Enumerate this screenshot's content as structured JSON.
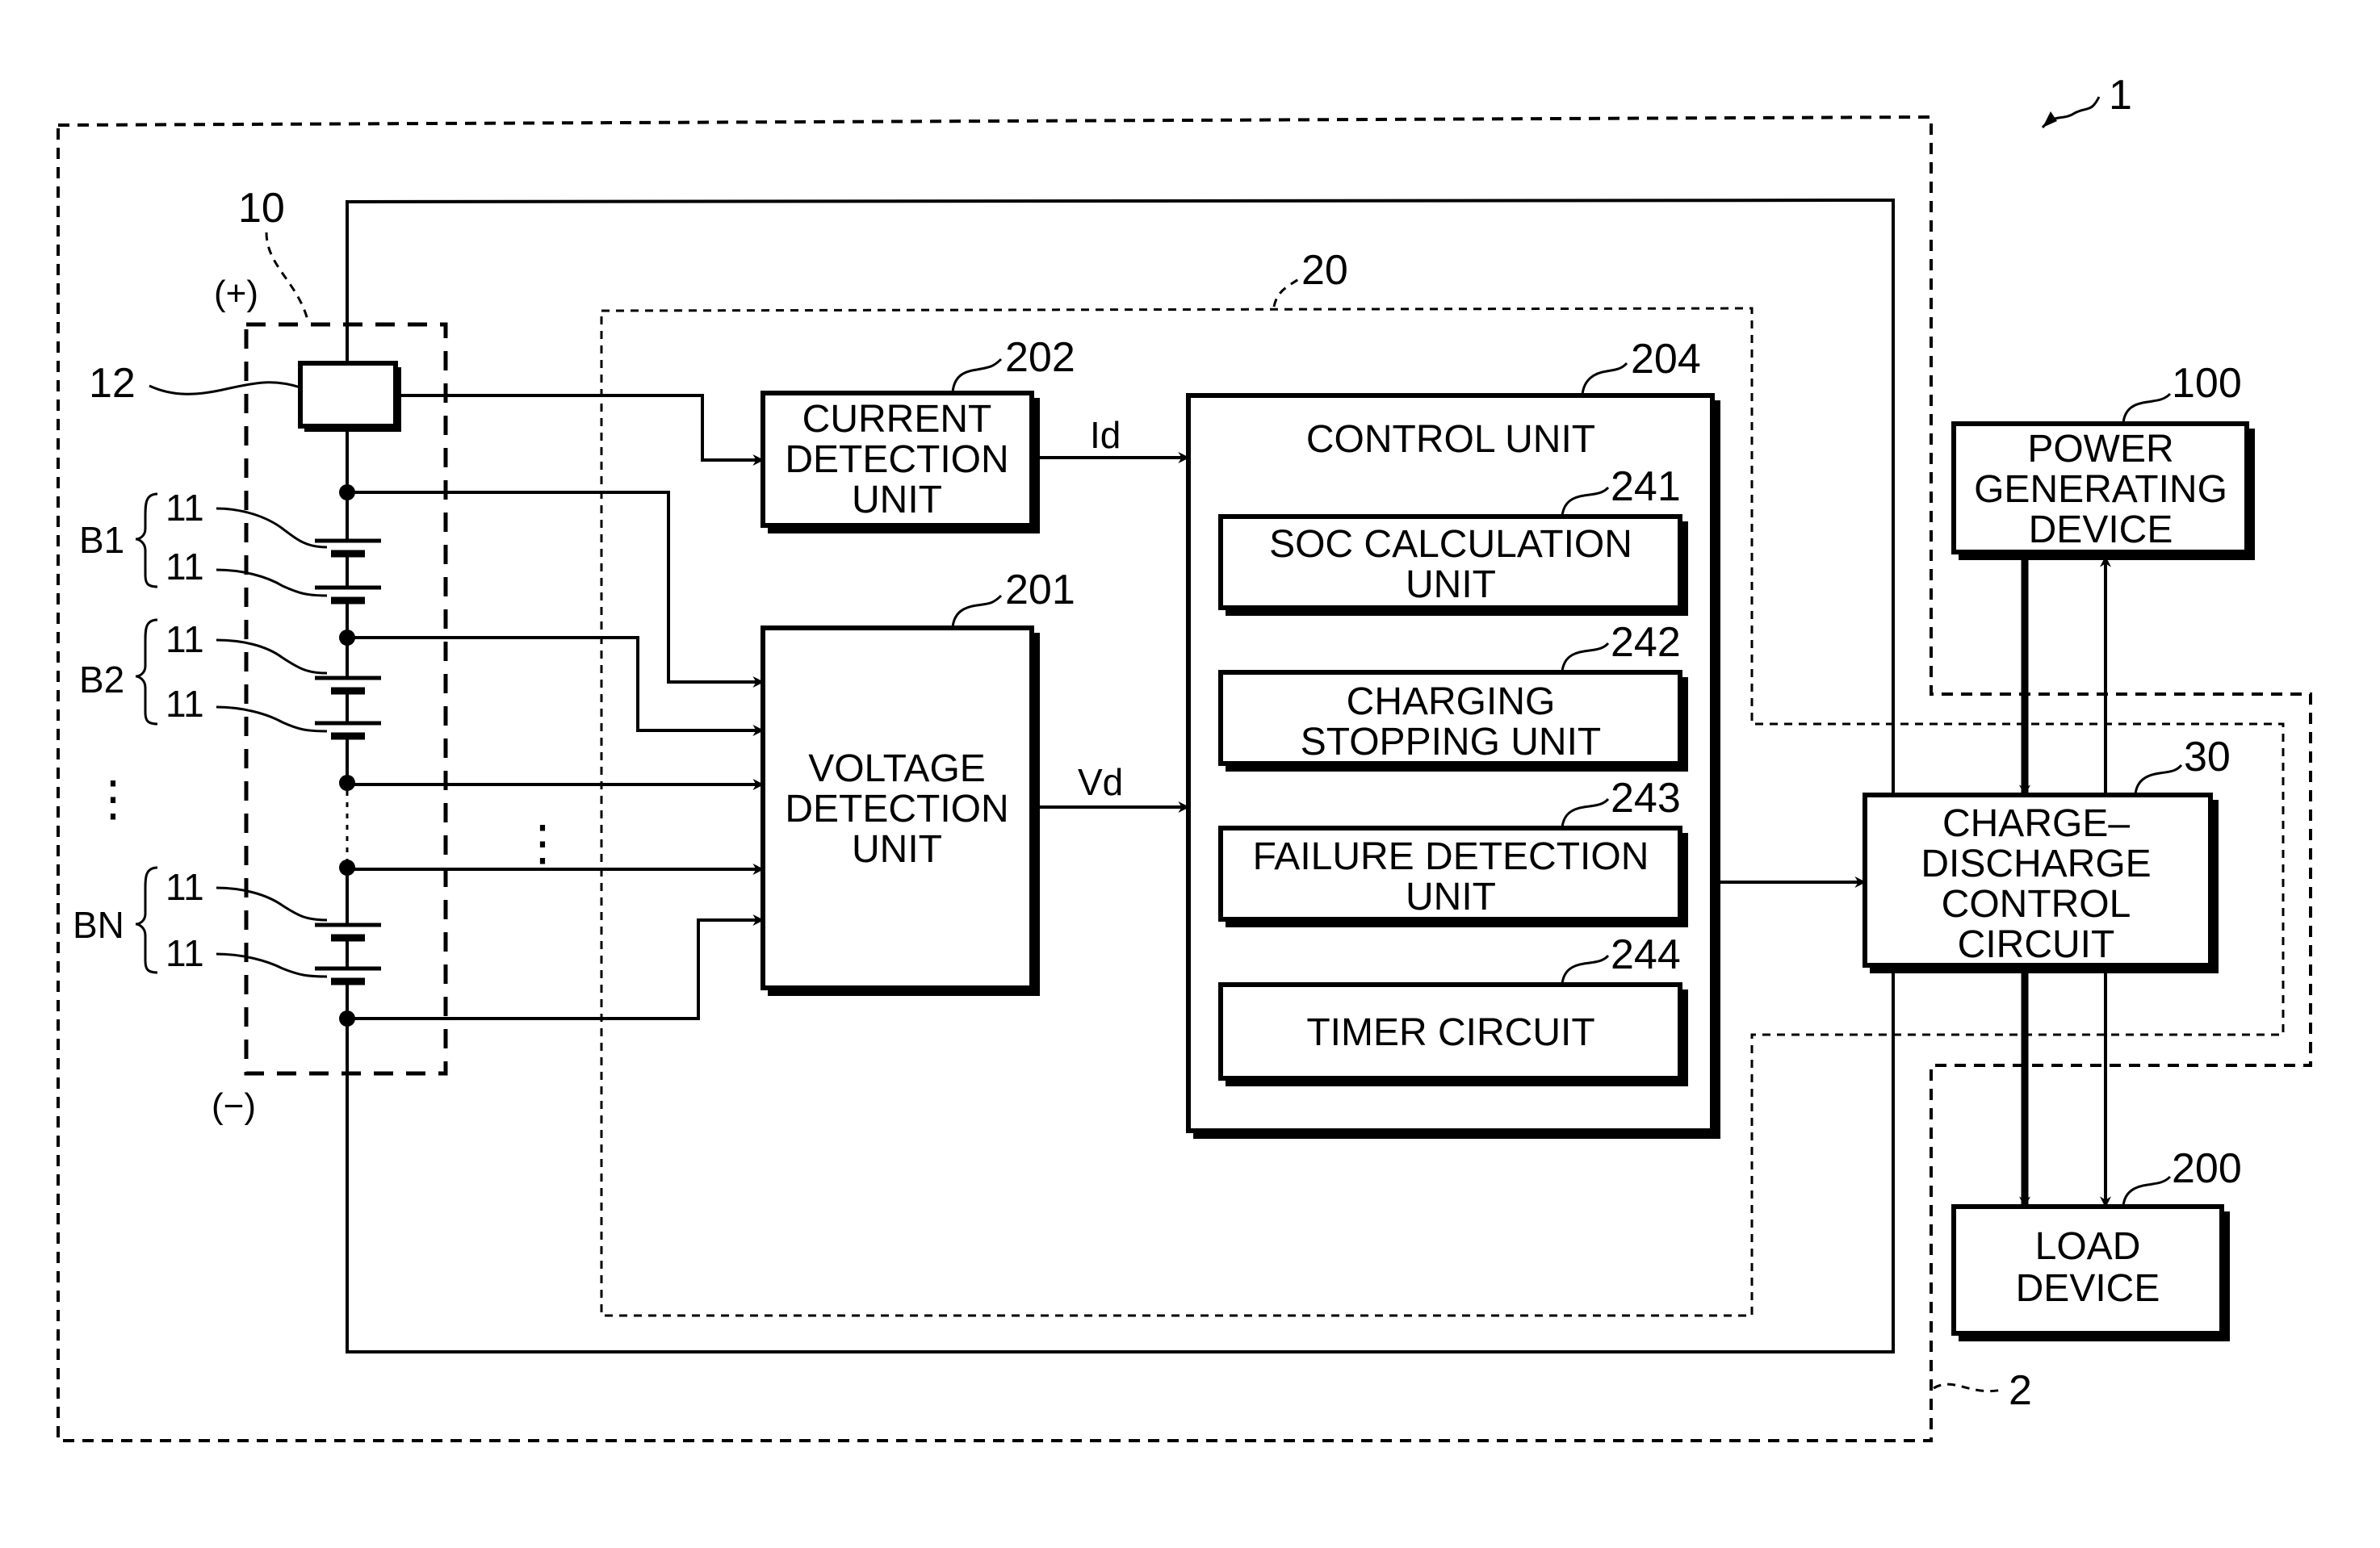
{
  "figure": {
    "system_ref": "1",
    "battery_system_ref": "2",
    "battery_module": {
      "ref": "10",
      "positive_label": "(+)",
      "negative_label": "(−)",
      "current_sensor_ref": "12",
      "cell_ref": "11",
      "blocks": [
        {
          "label": "B1",
          "cells": [
            "11",
            "11"
          ]
        },
        {
          "label": "B2",
          "cells": [
            "11",
            "11"
          ]
        },
        {
          "label": "BN",
          "cells": [
            "11",
            "11"
          ]
        }
      ],
      "ellipsis": "⋮"
    },
    "monitoring_unit": {
      "ref": "20",
      "current_detection": {
        "ref": "202",
        "lines": [
          "CURRENT",
          "DETECTION",
          "UNIT"
        ]
      },
      "voltage_detection": {
        "ref": "201",
        "lines": [
          "VOLTAGE",
          "DETECTION",
          "UNIT"
        ]
      },
      "signal_current": "Id",
      "signal_voltage": "Vd",
      "input_ellipsis": "⋮",
      "control_unit": {
        "ref": "204",
        "title": "CONTROL UNIT",
        "subunits": [
          {
            "ref": "241",
            "lines": [
              "SOC CALCULATION",
              "UNIT"
            ]
          },
          {
            "ref": "242",
            "lines": [
              "CHARGING",
              "STOPPING UNIT"
            ]
          },
          {
            "ref": "243",
            "lines": [
              "FAILURE DETECTION",
              "UNIT"
            ]
          },
          {
            "ref": "244",
            "lines": [
              "TIMER CIRCUIT"
            ]
          }
        ]
      }
    },
    "charge_discharge_circuit": {
      "ref": "30",
      "lines": [
        "CHARGE–",
        "DISCHARGE",
        "CONTROL",
        "CIRCUIT"
      ]
    },
    "power_generating_device": {
      "ref": "100",
      "lines": [
        "POWER",
        "GENERATING",
        "DEVICE"
      ]
    },
    "load_device": {
      "ref": "200",
      "lines": [
        "LOAD",
        "DEVICE"
      ]
    }
  }
}
